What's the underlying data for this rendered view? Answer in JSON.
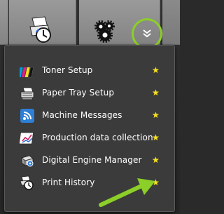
{
  "menu": {
    "items": [
      {
        "label": "Toner Setup",
        "icon": "toner-icon",
        "favorite": true
      },
      {
        "label": "Paper Tray Setup",
        "icon": "paper-tray-icon",
        "favorite": true
      },
      {
        "label": "Machine Messages",
        "icon": "machine-messages-icon",
        "favorite": true
      },
      {
        "label": "Production data collection",
        "icon": "production-data-icon",
        "favorite": true
      },
      {
        "label": "Digital Engine Manager",
        "icon": "digital-engine-icon",
        "favorite": true
      },
      {
        "label": "Print History",
        "icon": "print-history-icon",
        "favorite": true
      }
    ],
    "star_glyph": "★"
  },
  "toolbar": {
    "icons": [
      "print-history-icon",
      "gears-icon",
      "chevron-double-down-icon"
    ]
  },
  "colors": {
    "highlight": "#8ccf28",
    "star": "#f5e225",
    "panel": "#3b3b3b",
    "text": "#ffffff"
  }
}
